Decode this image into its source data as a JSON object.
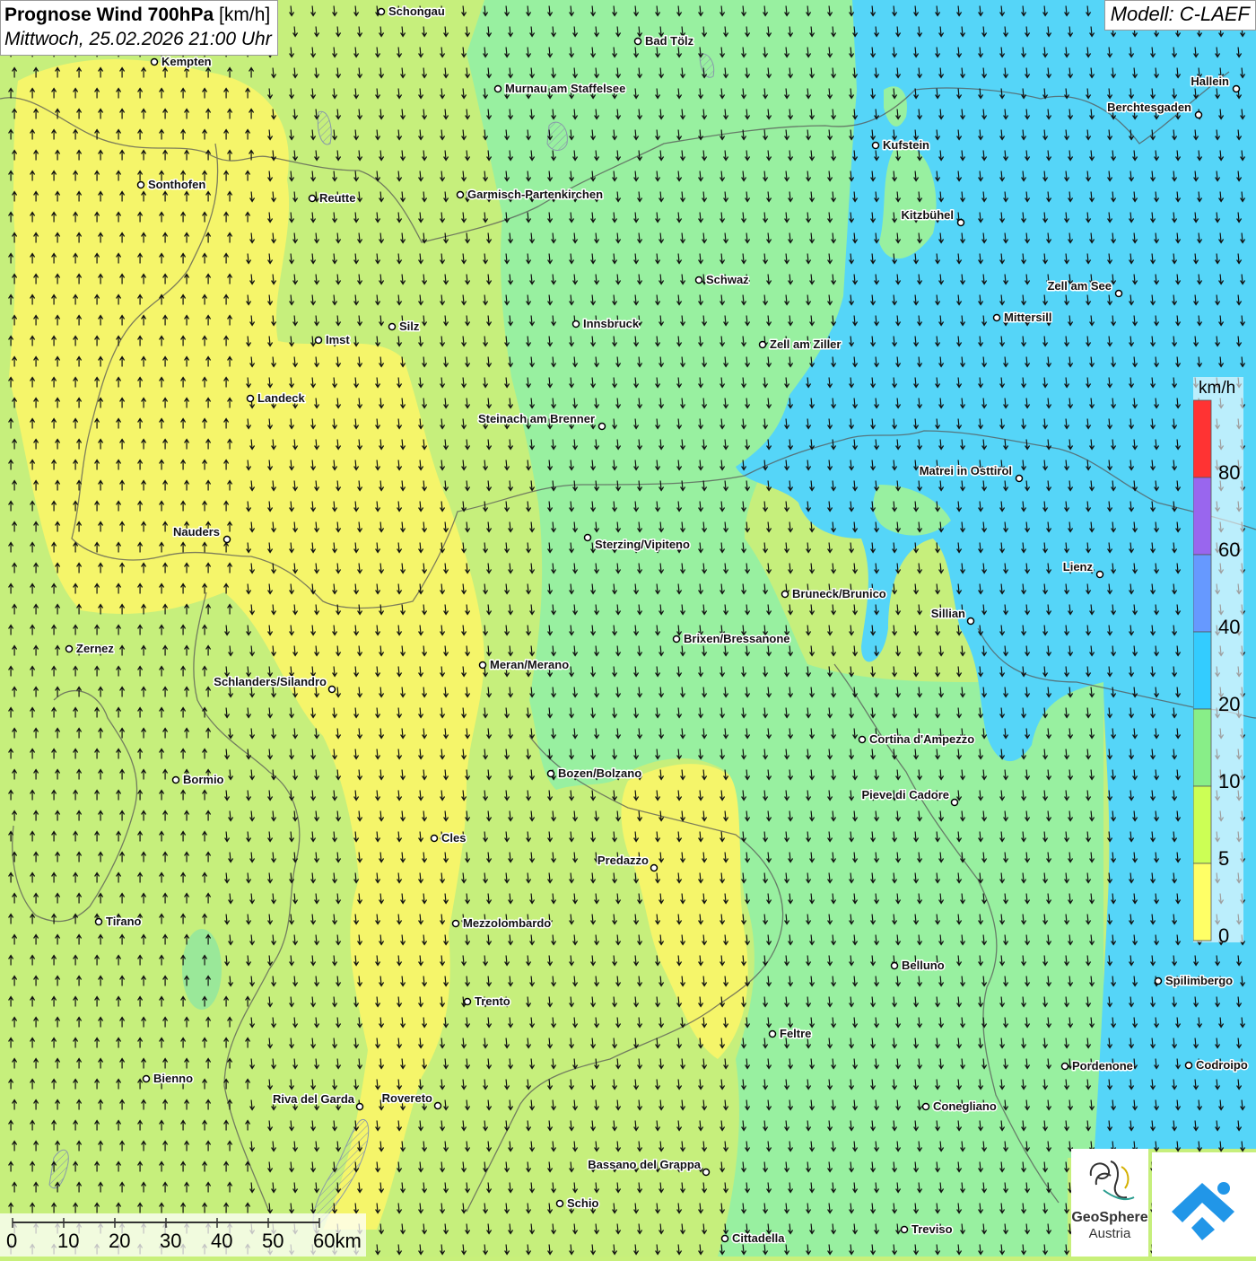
{
  "title": {
    "main": "Prognose Wind 700hPa",
    "unit": "[km/h]",
    "datetime": "Mittwoch, 25.02.2026 21:00 Uhr"
  },
  "model": "Modell: C-LAEF",
  "legend": {
    "unit": "km/h",
    "values": [
      "80",
      "60",
      "40",
      "20",
      "10",
      "5",
      "0"
    ],
    "colors": [
      "#ff3333",
      "#9966ee",
      "#6699ff",
      "#33ccff",
      "#88ee88",
      "#ccff55",
      "#ffff66"
    ]
  },
  "scale_bar": {
    "labels": [
      "0",
      "10",
      "20",
      "30",
      "40",
      "50",
      "60km"
    ]
  },
  "cities": [
    {
      "name": "Schongau"
    },
    {
      "name": "Bad Tölz"
    },
    {
      "name": "Kempten"
    },
    {
      "name": "Hallein"
    },
    {
      "name": "Murnau am Staffelsee"
    },
    {
      "name": "Berchtesgaden"
    },
    {
      "name": "Kufstein"
    },
    {
      "name": "Sonthofen"
    },
    {
      "name": "Reutte"
    },
    {
      "name": "Garmisch-Partenkirchen"
    },
    {
      "name": "Kitzbühel"
    },
    {
      "name": "Schwaz"
    },
    {
      "name": "Zell am See"
    },
    {
      "name": "Mittersill"
    },
    {
      "name": "Innsbruck"
    },
    {
      "name": "Silz"
    },
    {
      "name": "Imst"
    },
    {
      "name": "Zell am Ziller"
    },
    {
      "name": "Landeck"
    },
    {
      "name": "Steinach am Brenner"
    },
    {
      "name": "Matrei in Osttirol"
    },
    {
      "name": "Nauders"
    },
    {
      "name": "Sterzing/Vipiteno"
    },
    {
      "name": "Lienz"
    },
    {
      "name": "Bruneck/Brunico"
    },
    {
      "name": "Sillian"
    },
    {
      "name": "Brixen/Bressanone"
    },
    {
      "name": "Zernez"
    },
    {
      "name": "Meran/Merano"
    },
    {
      "name": "Schlanders/Silandro"
    },
    {
      "name": "Cortina d'Ampezzo"
    },
    {
      "name": "Bozen/Bolzano"
    },
    {
      "name": "Bormio"
    },
    {
      "name": "Pieve di Cadore"
    },
    {
      "name": "Cles"
    },
    {
      "name": "Predazzo"
    },
    {
      "name": "Tirano"
    },
    {
      "name": "Mezzolombardo"
    },
    {
      "name": "Belluno"
    },
    {
      "name": "Spilimbergo"
    },
    {
      "name": "Trento"
    },
    {
      "name": "Feltre"
    },
    {
      "name": "Bienno"
    },
    {
      "name": "Pordenone"
    },
    {
      "name": "Codroipo"
    },
    {
      "name": "Riva del Garda"
    },
    {
      "name": "Rovereto"
    },
    {
      "name": "Conegliano"
    },
    {
      "name": "Bassano del Grappa"
    },
    {
      "name": "Schio"
    },
    {
      "name": "Treviso"
    },
    {
      "name": "Cittadella"
    }
  ],
  "logos": {
    "geosphere_line1": "GeoSphere",
    "geosphere_line2": "Austria"
  },
  "wind_field": {
    "direction_west_part": "from south (arrows pointing up)",
    "direction_east_part": "from north (arrows pointing down)"
  }
}
